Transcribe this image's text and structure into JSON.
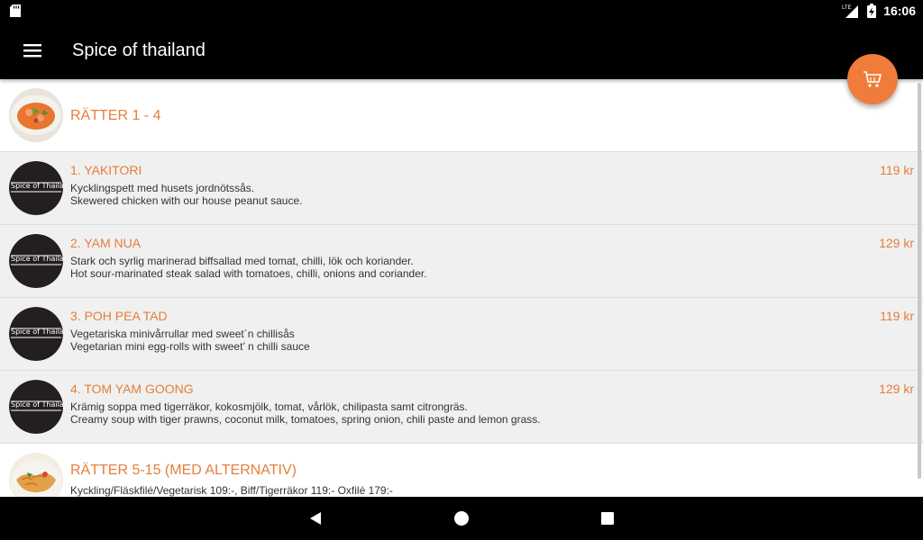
{
  "status_bar": {
    "time": "16:06",
    "network": "LTE"
  },
  "app_bar": {
    "title": "Spice of thailand"
  },
  "categories": [
    {
      "title": "RÄTTER 1 - 4"
    },
    {
      "title": "RÄTTER 5-15 (MED ALTERNATIV)",
      "description": "Kyckling/Fläskfilé/Vegetarisk 109:-, Biff/Tigerräkor 119:- Oxfilé 179:-"
    }
  ],
  "items": [
    {
      "name": "1. YAKITORI",
      "price": "119 kr",
      "desc_sv": "Kycklingspett med husets jordnötssås.",
      "desc_en": "Skewered chicken with our house peanut sauce."
    },
    {
      "name": "2. YAM NUA",
      "price": "129 kr",
      "desc_sv": "Stark och syrlig marinerad biffsallad med tomat, chilli, lök och koriander.",
      "desc_en": "Hot sour-marinated steak salad with tomatoes, chilli, onions and coriander."
    },
    {
      "name": "3. POH PEA TAD",
      "price": "119 kr",
      "desc_sv": "Vegetariska minivårrullar med sweet´n chillisås",
      "desc_en": "Vegetarian mini egg-rolls with sweet’ n chilli sauce"
    },
    {
      "name": "4. TOM YAM GOONG",
      "price": "129 kr",
      "desc_sv": "Krämig soppa med tigerräkor, kokosmjölk, tomat, vårlök, chilipasta samt citrongräs.",
      "desc_en": "Creamy soup with tiger prawns, coconut milk, tomatoes, spring onion, chili paste and lemon grass."
    }
  ],
  "logo_text": "Spice of Thailand",
  "colors": {
    "accent": "#e67e3a",
    "fab": "#ef7c3a",
    "bar": "#000000",
    "item_bg": "#f0f0f0"
  },
  "icons": {
    "menu": "hamburger-menu-icon",
    "cart": "shopping-cart-icon",
    "back": "back-triangle-icon",
    "home": "home-circle-icon",
    "recents": "recents-square-icon"
  }
}
